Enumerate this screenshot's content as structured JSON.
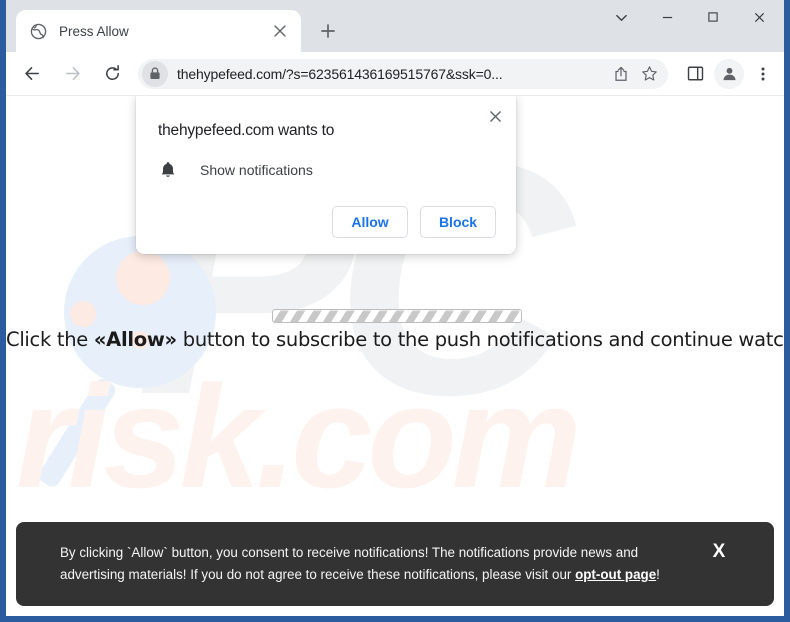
{
  "browser": {
    "tab": {
      "title": "Press Allow",
      "favicon": "globe-icon",
      "close_label": "×"
    },
    "new_tab_label": "+",
    "window_controls": {
      "tab_search": "tab-search-chevron-down-icon",
      "minimize": "minimize-icon",
      "maximize": "maximize-icon",
      "close": "close-icon"
    },
    "nav": {
      "back": "back-arrow-icon",
      "forward": "forward-arrow-icon",
      "reload": "reload-icon"
    },
    "omnibox": {
      "url": "thehypefeed.com/?s=623561436169515767&ssk=0...",
      "site_info_icon": "lock-icon",
      "share_icon": "share-icon",
      "bookmark_icon": "star-icon"
    },
    "toolbar": {
      "side_panel_icon": "side-panel-icon",
      "profile_icon": "profile-avatar-icon",
      "menu_icon": "three-dot-menu-icon"
    }
  },
  "permission_dialog": {
    "title": "thehypefeed.com wants to",
    "permission_icon": "bell-icon",
    "permission_label": "Show notifications",
    "allow_label": "Allow",
    "block_label": "Block",
    "close_label": "×"
  },
  "page": {
    "loader": "striped-progress-bar",
    "cta_prefix": "Click the ",
    "cta_bold": "«Allow»",
    "cta_suffix": " button to subscribe to the push notifications and continue watching",
    "watermark_pc": "PC",
    "watermark_risk": "risk.com"
  },
  "consent_banner": {
    "text_part1": "By clicking `Allow` button, you consent to receive notifications! The notifications provide news and advertising materials! If you do not agree to receive these notifications, please visit our ",
    "link_label": "opt-out page",
    "text_part2": "!",
    "close_label": "X"
  },
  "colors": {
    "frame_blue": "#2b5ca0",
    "tabstrip": "#dee1e6",
    "accent_blue": "#1a73e8",
    "banner_dark": "#333333",
    "watermark_grey": "#f1f2f3",
    "watermark_pink": "#fdf2ee"
  }
}
